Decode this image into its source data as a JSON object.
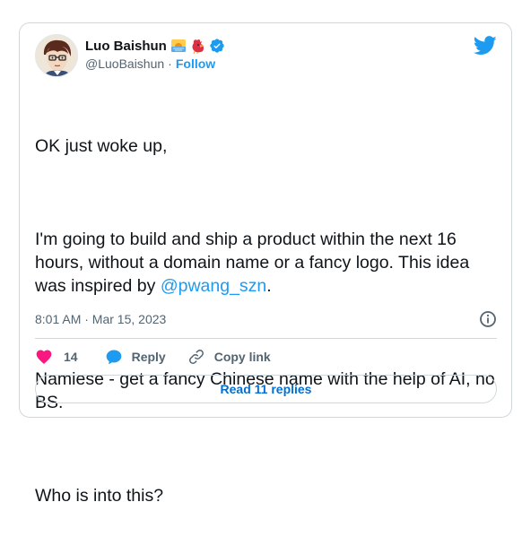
{
  "tweet": {
    "author": {
      "display_name": "Luo Baishun",
      "handle": "@LuoBaishun",
      "separator": "·",
      "follow_label": "Follow",
      "avatar_icon": "avatar-illustration",
      "emoji_icons": [
        "sunrise-emoji",
        "rooster-emoji"
      ],
      "verified_icon": "verified-badge-icon"
    },
    "text": {
      "line1": "OK just woke up,",
      "para2": "I'm going to build and ship a product within the next 16 hours, without a domain name or a fancy logo. This idea was inspired by ",
      "mention": "@pwang_szn",
      "para2_end": ".",
      "para3": "Namiese - get a fancy Chinese name with the help of AI, no BS.",
      "para4": "Who is into this?"
    },
    "timestamp": "8:01 AM · Mar 15, 2023",
    "actions": {
      "like_count": "14",
      "reply_label": "Reply",
      "copy_link_label": "Copy link"
    },
    "read_replies_label": "Read 11 replies"
  },
  "colors": {
    "accent": "#1d9bf0",
    "like": "#f91880",
    "border": "#cfd9de",
    "muted": "#536471"
  }
}
